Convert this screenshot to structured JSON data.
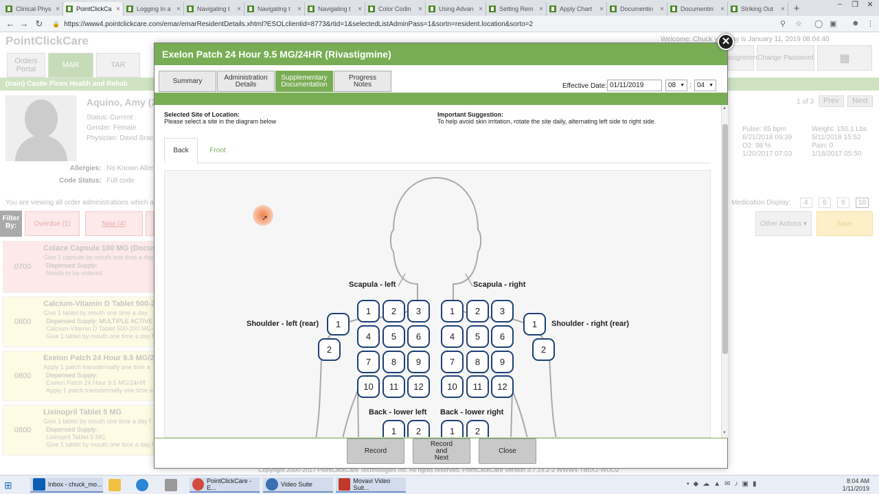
{
  "browser": {
    "tabs": [
      {
        "label": "Clinical Phys"
      },
      {
        "label": "PointClickCa"
      },
      {
        "label": "Logging In a"
      },
      {
        "label": "Navigating t"
      },
      {
        "label": "Navigating t"
      },
      {
        "label": "Navigating t"
      },
      {
        "label": "Color Codin"
      },
      {
        "label": "Using Advan"
      },
      {
        "label": "Setting Rem"
      },
      {
        "label": "Apply Chart"
      },
      {
        "label": "Documentin"
      },
      {
        "label": "Documentin"
      },
      {
        "label": "Striking Out"
      }
    ],
    "url": "https://www4.pointclickcare.com/emar/emarResidentDetails.xhtml?ESOLclientid=8773&rtid=1&selectedListAdminPass=1&sortn=resident.location&sorto=2",
    "close_glyph": "×",
    "new_tab_glyph": "+"
  },
  "background": {
    "logo": "PointClickCare",
    "nav_tabs": [
      "Orders Portal",
      "MAR",
      "TAR"
    ],
    "welcome": "Welcome: Chuck   y.   Today is January 11, 2019   08:04:40",
    "top_buttons": [
      "Assignment",
      "Change Password"
    ],
    "facility": "(train) Castle Pines Health and Rehab",
    "resident_name": "Aquino, Amy (2",
    "status": "Status: Current",
    "gender": "Gender: Female",
    "physician": "Physician: David Brac",
    "allergies_label": "Allergies:",
    "allergies_value": "No Known Aller",
    "code_status_label": "Code Status:",
    "code_status_value": "Full code",
    "pager": {
      "count": "1 of 3",
      "prev": "Prev",
      "next": "Next"
    },
    "vitals": {
      "pulse": "Pulse: 85 bpm",
      "pulse_date": "6/21/2018 09:39",
      "o2": "O2: 98 %",
      "o2_date": "1/20/2017 07:03",
      "weight": "Weight: 150.1 Lbs",
      "weight_date": "5/11/2018 15:52",
      "pain": "Pain: 0",
      "pain_date": "1/18/2017 05:50"
    },
    "viewing_text": "You are viewing all order administrations which a",
    "med_display_label": "Medication Display:",
    "med_display_options": [
      "4",
      "6",
      "8",
      "10"
    ],
    "filter_label": "Filter By:",
    "filter_buttons": [
      "Overdue (1)",
      "Now (4)"
    ],
    "other_actions": "Other Actions ▾",
    "save": "Save",
    "meds": [
      {
        "time": "0700",
        "title": "Colace Capsule 100 MG (Docusate",
        "line1": "Give 1 capsule by mouth one time a day",
        "supply_label": "Dispensed Supply:",
        "line2": "Needs to be ordered",
        "line3": ""
      },
      {
        "time": "0800",
        "title": "Calcium-Vitamin D Tablet 500-200",
        "line1": "Give 1 tablet by mouth one time a day",
        "supply_label": "Dispensed Supply: MULTIPLE ACTIVE SU",
        "line2": "Calcium-Vitamin D Tablet 500-200 MG-UN",
        "line3": "Give 1 tablet by mouth one time a day for"
      },
      {
        "time": "0800",
        "title": "Exelon Patch 24 Hour 9.5 MG/24H",
        "line1": "Apply 1 patch transdermally one time a",
        "supply_label": "Dispensed Supply:",
        "line2": "Exelon Patch 24 Hour 9.5 MG/24HR",
        "line3": "Apply 1 patch transdermally one time a day"
      },
      {
        "time": "0800",
        "title": "Lisinopril Tablet 5 MG",
        "line1": "Give 1 tablet by mouth one time a day f",
        "supply_label": "Dispensed Supply:",
        "line2": "Lisinopril Tablet 5 MG",
        "line3": "Give 1 tablet by mouth one time a day for"
      }
    ],
    "copyright": "Copyright 2000-2017 PointClickCare Technologies Inc. All rights reserved.  PointClickCare Version 3.7.19.2-2  WWW4-TB0X2-WUO2"
  },
  "modal": {
    "title": "Exelon Patch 24 Hour 9.5 MG/24HR (Rivastigmine)",
    "close_glyph": "✕",
    "tabs": [
      "Summary",
      "Administration Details",
      "Supplementary Documentation",
      "Progress Notes"
    ],
    "effective_label": "Effective Date:",
    "effective_date": "01/11/2019",
    "hour": "08",
    "minute": "04",
    "time_sep": ":",
    "selected_site_heading": "Selected Site of Location:",
    "selected_site_text": "Please select a site in the diagram below",
    "suggestion_heading": "Important Suggestion:",
    "suggestion_text": "To help avoid skin irritation, rotate the site daily, alternating left side to right side.",
    "site_tabs": [
      "Back",
      "Front"
    ],
    "regions": {
      "scapula_left": "Scapula - left",
      "scapula_right": "Scapula - right",
      "shoulder_left": "Shoulder - left (rear)",
      "shoulder_right": "Shoulder - right (rear)",
      "lower_left": "Back - lower left",
      "lower_right": "Back - lower right"
    },
    "site_numbers": [
      "1",
      "2",
      "3",
      "4",
      "5",
      "6",
      "7",
      "8",
      "9",
      "10",
      "11",
      "12"
    ],
    "buttons": [
      "Record",
      "Record and Next",
      "Close"
    ]
  },
  "taskbar": {
    "items": [
      "Inbox - chuck_mo...",
      "PointClickCare - E...",
      "Video Suite",
      "Movavi Video Suit..."
    ],
    "time": "8:04 AM",
    "date": "1/11/2019"
  },
  "colors": {
    "modal_green": "#79ad55",
    "site_border": "#1c3f74"
  }
}
